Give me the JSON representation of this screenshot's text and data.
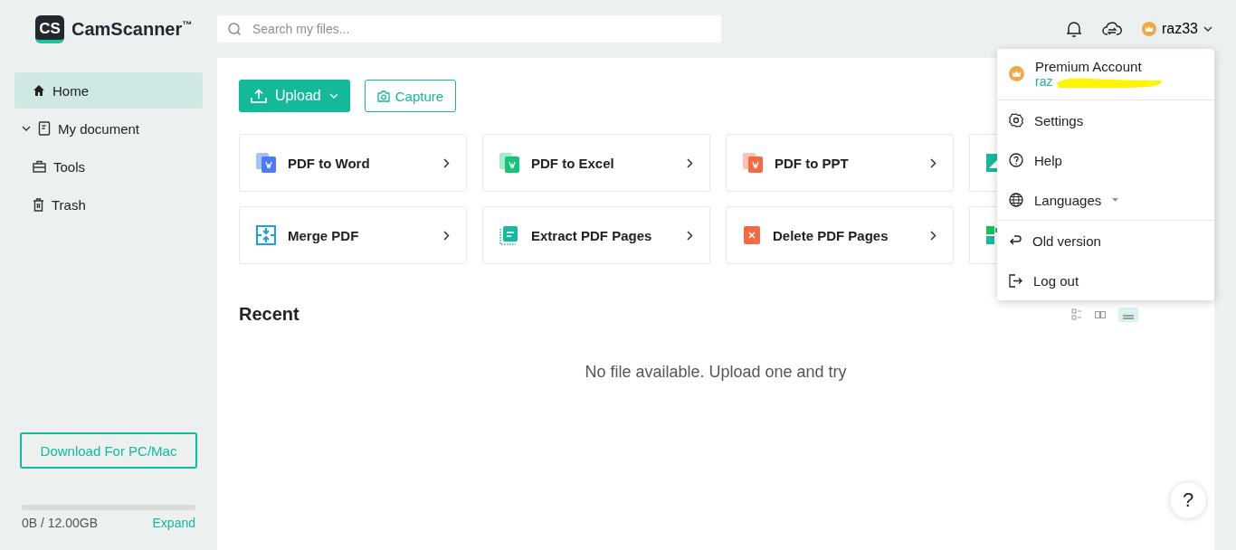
{
  "logo": {
    "badge": "CS",
    "name": "CamScanner",
    "mark": "™"
  },
  "search": {
    "placeholder": "Search my files..."
  },
  "user": {
    "name": "raz33"
  },
  "sidebar": {
    "items": [
      {
        "label": "Home",
        "selected": true,
        "expandable": false
      },
      {
        "label": "My document",
        "selected": false,
        "expandable": true
      },
      {
        "label": "Tools",
        "selected": false,
        "expandable": false
      },
      {
        "label": "Trash",
        "selected": false,
        "expandable": false
      }
    ],
    "download_button": "Download For PC/Mac",
    "storage": {
      "level": 0,
      "usage": "0B / 12.00GB",
      "action": "Expand"
    }
  },
  "toolbar": {
    "upload": "Upload",
    "capture": "Capture"
  },
  "tools": [
    {
      "kind": "tool",
      "label": "PDF to Word"
    },
    {
      "kind": "tool",
      "label": "PDF to Excel"
    },
    {
      "kind": "tool",
      "label": "PDF to PPT"
    },
    {
      "kind": "covered"
    },
    {
      "kind": "tool",
      "label": "Merge PDF"
    },
    {
      "kind": "tool",
      "label": "Extract PDF Pages"
    },
    {
      "kind": "tool",
      "label": "Delete PDF Pages"
    },
    {
      "kind": "covered"
    }
  ],
  "recent": {
    "title": "Recent",
    "empty": "No file available. Upload one and try"
  },
  "account_menu": {
    "account_type": "Premium Account",
    "email": "raz",
    "items": [
      {
        "label": "Settings",
        "divider_after": false,
        "submenu": false
      },
      {
        "label": "Help",
        "divider_after": false,
        "submenu": false
      },
      {
        "label": "Languages",
        "divider_after": true,
        "submenu": true
      },
      {
        "label": "Old version",
        "divider_after": false,
        "submenu": false
      },
      {
        "label": "Log out",
        "divider_after": false,
        "submenu": false
      }
    ]
  },
  "help_button": "?"
}
